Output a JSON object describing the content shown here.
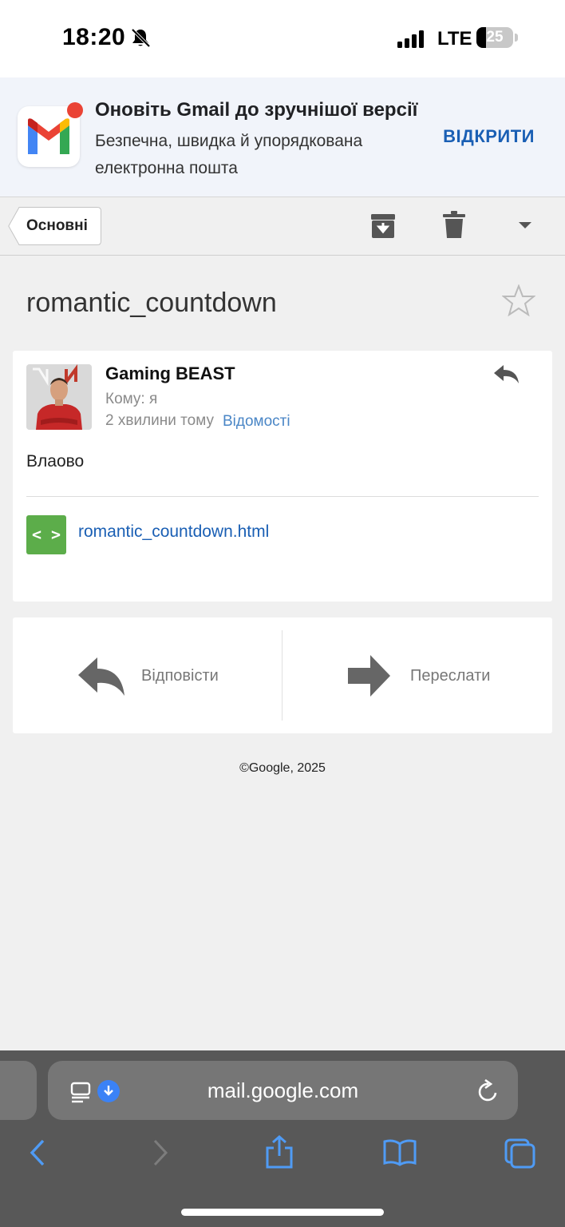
{
  "status_bar": {
    "time": "18:20",
    "network": "LTE",
    "battery_percent": "25",
    "battery_level": 0.25,
    "icons": [
      "bell-slash-icon",
      "cellular-signal-icon",
      "battery-icon"
    ]
  },
  "promo": {
    "title": "Оновіть Gmail до зручнішої версії",
    "subtitle": "Безпечна, швидка й упорядкована електронна пошта",
    "open_label": "ВІДКРИТИ",
    "icon": "gmail-logo-icon"
  },
  "toolbar": {
    "back_label": "Основні",
    "icons": [
      "archive-icon",
      "trash-icon",
      "chevron-down-icon"
    ]
  },
  "email": {
    "subject": "romantic_countdown",
    "sender": "Gaming BEAST",
    "to": "Кому: я",
    "time_ago": "2 хвилини тому",
    "details_link": "Відомості",
    "body": "Влаово",
    "attachment": {
      "name": "romantic_countdown.html",
      "icon_glyph": "< >"
    }
  },
  "actions": {
    "reply_label": "Відповісти",
    "forward_label": "Переслати"
  },
  "footer": {
    "copyright": "©Google, 2025"
  },
  "safari": {
    "url": "mail.google.com"
  },
  "colors": {
    "accent_blue": "#1a5fb4",
    "link_blue": "#4a86c6",
    "attachment_green": "#5cad4a",
    "gmail_red": "#ea4335",
    "safari_bar": "#585858",
    "safari_icon_blue": "#3b82f6"
  }
}
